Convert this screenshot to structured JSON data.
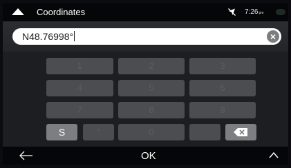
{
  "topbar": {
    "title": "Coordinates",
    "time": "7:26",
    "ampm": "pm"
  },
  "input": {
    "value": "N48.76998°",
    "clear_label": "×"
  },
  "keypad": {
    "keys": [
      "1",
      "2",
      "3",
      "4",
      "5",
      "6",
      "7",
      "8",
      "9"
    ],
    "s_label": "S",
    "degree_label": "'",
    "zero_label": "0",
    "dot_label": ".",
    "backspace_icon": "backspace-icon"
  },
  "bottombar": {
    "ok_label": "OK",
    "back_icon": "back-arrow-icon",
    "expand_icon": "chevron-up-icon"
  },
  "colors": {
    "background": "#242629",
    "bar": "#050608",
    "key": "#4b4d51",
    "active_key": "#7d7e82"
  }
}
